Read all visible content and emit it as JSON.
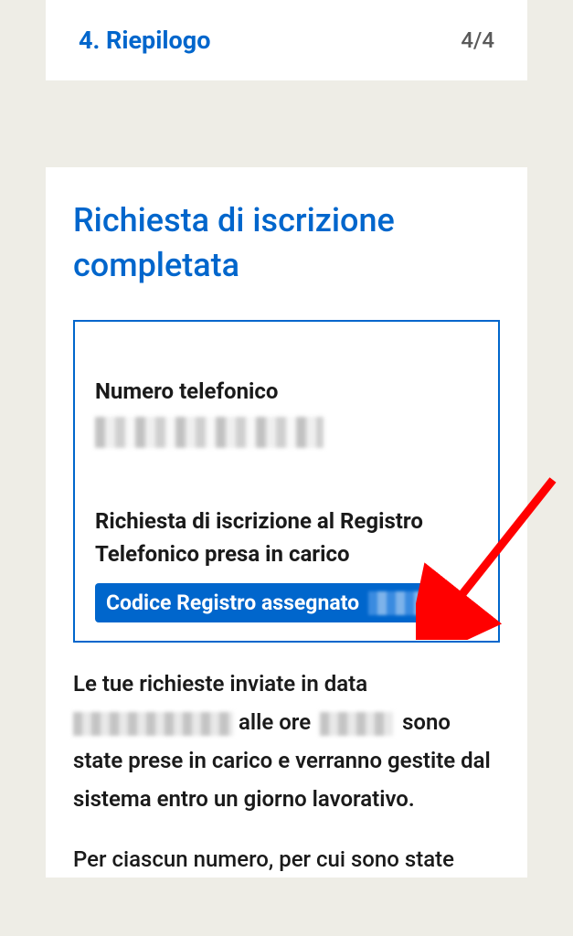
{
  "header": {
    "title": "4. Riepilogo",
    "step": "4/4"
  },
  "main": {
    "heading": "Richiesta di iscrizione completata",
    "phone_label": "Numero telefonico",
    "request_status": "Richiesta di iscrizione al Registro Telefonico presa in carico",
    "code_label": "Codice Registro assegnato",
    "body_part1": "Le tue richieste inviate in data",
    "body_part2": "alle ore",
    "body_part3": "sono state prese in carico e verranno gestite dal sistema entro un giorno lavorativo.",
    "body2": "Per ciascun numero, per cui sono state"
  }
}
